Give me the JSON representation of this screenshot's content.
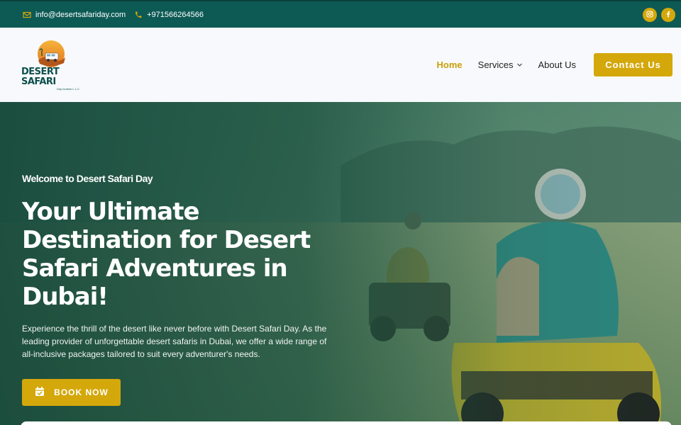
{
  "topbar": {
    "email": "info@desertsafariday.com",
    "phone": "+971566264566",
    "social": [
      {
        "icon": "instagram-icon"
      },
      {
        "icon": "facebook-icon"
      }
    ],
    "colors": {
      "bg": "#0d5a55",
      "accent": "#d4a80b"
    }
  },
  "header": {
    "logo": {
      "brand": "DESERT SAFARI",
      "sub": "Day tourism L.L.C"
    },
    "nav": [
      {
        "label": "Home",
        "active": true
      },
      {
        "label": "Services",
        "has_dropdown": true
      },
      {
        "label": "About Us"
      }
    ],
    "contact_button": "Contact Us"
  },
  "hero": {
    "welcome": "Welcome to Desert Safari Day",
    "headline": "Your Ultimate Destination for Desert Safari Adventures in Dubai!",
    "description": "Experience the thrill of the desert like never before with Desert Safari Day. As the leading provider of unforgettable desert safaris in Dubai, we offer a wide range of all-inclusive packages tailored to suit every adventurer's needs.",
    "book_button": "BOOK NOW"
  }
}
